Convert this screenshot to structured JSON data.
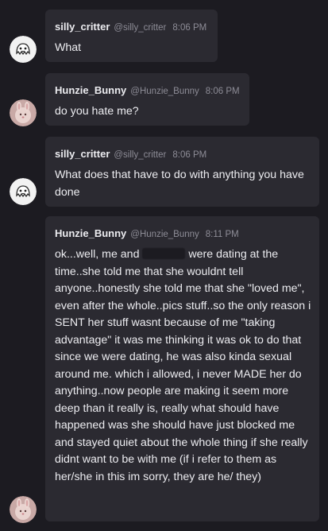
{
  "messages": [
    {
      "author": "silly_critter",
      "handle": "@silly_critter",
      "time": "8:06 PM",
      "text": "What",
      "avatar": "ghost-avatar-icon"
    },
    {
      "author": "Hunzie_Bunny",
      "handle": "@Hunzie_Bunny",
      "time": "8:06 PM",
      "text": "do you hate me?",
      "avatar": "bunny-avatar-icon"
    },
    {
      "author": "silly_critter",
      "handle": "@silly_critter",
      "time": "8:06 PM",
      "text": "What does that have to do with anything you have done",
      "avatar": "ghost-avatar-icon"
    },
    {
      "author": "Hunzie_Bunny",
      "handle": "@Hunzie_Bunny",
      "time": "8:11 PM",
      "text_before_redaction": "ok...well, me and",
      "text_after_redaction": "were dating at the time..she told me that she wouldnt tell anyone..honestly she told me that she \"loved me\", even after the whole..pics stuff..so the only reason i SENT her stuff wasnt because of me \"taking advantage\" it was me thinking it was ok to do that since we were dating, he was also kinda sexual around me. which i allowed, i never MADE her do anything..now people are making it seem more deep than it really is, really what should have happened was she should have just blocked me and stayed quiet about the whole thing if she really didnt want to be with me (if i refer to them as her/she in this im sorry, they are he/ they)",
      "avatar": "bunny-avatar-icon"
    }
  ],
  "colors": {
    "background": "#1c1b21",
    "bubble": "#2b2a31",
    "text": "#ececf0",
    "muted": "#8d8c96"
  }
}
